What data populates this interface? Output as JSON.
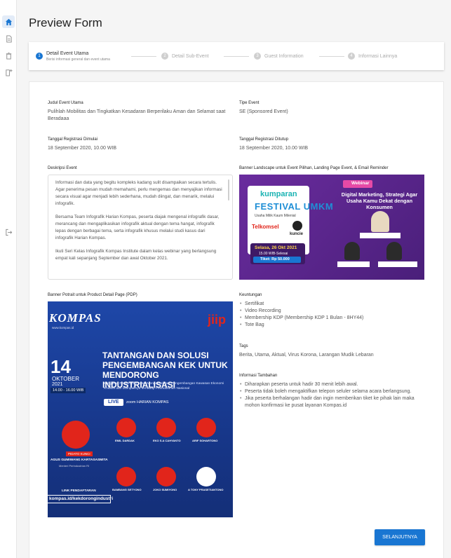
{
  "rail": {
    "items": [
      {
        "icon": "home-icon",
        "active": true
      },
      {
        "icon": "document-icon",
        "active": false
      },
      {
        "icon": "trash-icon",
        "active": false
      },
      {
        "icon": "add-document-icon",
        "active": false
      },
      {
        "icon": "logout-icon",
        "active": false
      }
    ]
  },
  "page": {
    "title": "Preview Form"
  },
  "stepper": {
    "steps": [
      {
        "number": "1",
        "label": "Detail Event Utama",
        "sublabel": "Berisi informasi general dan event utama",
        "active": true
      },
      {
        "number": "2",
        "label": "Detail Sub-Event",
        "active": false
      },
      {
        "number": "3",
        "label": "Guest Information",
        "active": false
      },
      {
        "number": "4",
        "label": "Informasi Lainnya",
        "active": false
      }
    ]
  },
  "form": {
    "judul": {
      "label": "Judul Event Utama",
      "value": "Pulihlah Mobilitas dan Tingkatkan Kesadaran Berperilaku Aman dan Selamat saat Beradaaa"
    },
    "tipe": {
      "label": "Tipe Event",
      "value": "SE (Sponsored Event)"
    },
    "reg_mulai": {
      "label": "Tanggal Registrasi Dimulai",
      "value": "18 September 2020, 10.00 WIB"
    },
    "reg_tutup": {
      "label": "Tanggal Registrasi Ditutup",
      "value": "18 September 2020, 10.00 WIB"
    },
    "deskripsi": {
      "label": "Deskripsi Event",
      "paragraphs": [
        "Informasi dan data yang begitu kompleks kadang sulit disampaikan secara tertulis. Agar penerima pesan mudah memahami, perlu mengemas dan menyajikan informasi secara visual agar menjadi lebih sederhana, mudah diingat, dan menarik, melalui infografik.",
        "Bersama Team Infografik Harian Kompas, peserta diajak mengenal infografik dasar, merancang dan mengaplikasikan infografik aktual dengan tema hangat, infografik lepas dengan berbagai tema, serta infografik khusus melalui studi kasus dari infografik Harian Kompas.",
        "Ikuti Seri Kelas Infografik Kompas Institute dalam kelas webinar yang berlangsung empat kali sepanjang September dan awal Oktober 2021."
      ]
    },
    "banner_landscape": {
      "label": "Banner Landscape untuk Event Pilihan, Landing Page Event, & Email Reminder",
      "brand": "kumparan",
      "event_logo": "FESTIVAL UMKM",
      "event_sub": "Usaha Milik Kaum Milenial",
      "sponsor1": "Telkomsel",
      "sponsor2": "kuncie",
      "badge": "Webinar",
      "headline": "Digital Marketing, Strategi Agar Usaha Kamu Dekat dengan Konsumen",
      "date": "Selasa, 26 Okt 2021",
      "time": "15.00 WIB-Selesai",
      "ticket": "Tiket: Rp 50.000"
    },
    "banner_portrait": {
      "label": "Banner Potrait untuk Product Detail Page (PDP)",
      "brand": "KOMPAS",
      "brand_sub": "www.kompas.id",
      "partner": "jiip",
      "day": "14",
      "month": "OKTOBER",
      "year": "2021",
      "time": "14.00 - 16.00 WIB",
      "headline": "TANTANGAN DAN SOLUSI PENGEMBANGAN KEK UNTUK MENDORONG INDUSTRIALISASI",
      "subheadline": "Kebijakan Pemerintah untuk Mengakselerasi Pengembangan Kawasan Ekonomi Khusus dan Dampaknya terhadap Perindustrian Nasional",
      "live": "LIVE",
      "live_platforms": "zoom  HARIAN KOMPAS",
      "keynote_tag": "PIDATO KUNCI",
      "keynote_name": "AGUS GUMIWANG KARTASASMITA",
      "keynote_role": "Menteri Perindustrian RI",
      "speakers": [
        {
          "name": "EMIL DARDAK"
        },
        {
          "name": "EKO S.A CAHYANTO"
        },
        {
          "name": "ARIF SOHARTONO"
        },
        {
          "name": "BAMBANG SETYONO"
        },
        {
          "name": "JOKO SUMIYONO"
        },
        {
          "name": "A TONY PRASETIANTONO"
        }
      ],
      "reg_label": "LINK PENDAFTARAN",
      "reg_url": "kompas.id/kekdorongindustri"
    },
    "keuntungan": {
      "label": "Keuntungan",
      "items": [
        "Sertifikat",
        "Video Recording",
        "Membership KDP (Membership KDP 1 Bulan - 8HY44)",
        "Tote Bag"
      ]
    },
    "tags": {
      "label": "Tags",
      "value": "Berita, Utama, Aktual, Virus Korona, Larangan Mudik Lebaran"
    },
    "info": {
      "label": "Informasi Tambahan",
      "items": [
        "Diharapkan peserta untuk hadir 30 menit lebih awal.",
        "Peserta tidak boleh mengaktifkan telepon seluler selama acara berlangsung.",
        "Jika peserta berhalangan hadir dan ingin memberikan tiket ke pihak lain maka mohon konfirmasi ke pusat layanan Kompas.id"
      ]
    }
  },
  "actions": {
    "next_label": "SELANJUTNYA"
  },
  "colors": {
    "primary": "#1976d2",
    "banner_purple": "#5a2a8a",
    "banner_blue": "#1c3f9a"
  }
}
